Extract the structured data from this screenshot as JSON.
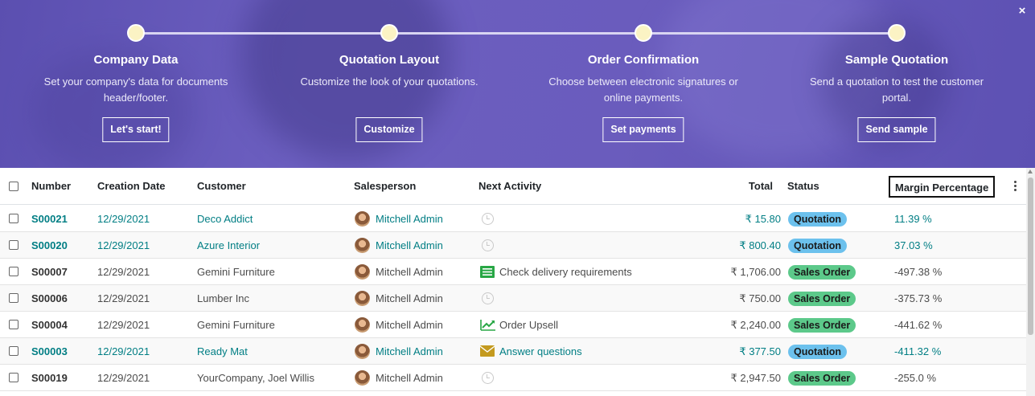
{
  "banner": {
    "close_label": "×",
    "steps": [
      {
        "title": "Company Data",
        "desc": "Set your company's data for documents header/footer.",
        "button": "Let's start!"
      },
      {
        "title": "Quotation Layout",
        "desc": "Customize the look of your quotations.",
        "button": "Customize"
      },
      {
        "title": "Order Confirmation",
        "desc": "Choose between electronic signatures or online payments.",
        "button": "Set payments"
      },
      {
        "title": "Sample Quotation",
        "desc": "Send a quotation to test the customer portal.",
        "button": "Send sample"
      }
    ]
  },
  "table": {
    "headers": {
      "number": "Number",
      "creation_date": "Creation Date",
      "customer": "Customer",
      "salesperson": "Salesperson",
      "next_activity": "Next Activity",
      "total": "Total",
      "status": "Status",
      "margin": "Margin Percentage"
    },
    "rows": [
      {
        "number": "S00021",
        "date": "12/29/2021",
        "customer": "Deco Addict",
        "salesperson": "Mitchell Admin",
        "activity": "",
        "activity_icon": "clock-icon",
        "total": "₹ 15.80",
        "status": "Quotation",
        "margin": "11.39 %"
      },
      {
        "number": "S00020",
        "date": "12/29/2021",
        "customer": "Azure Interior",
        "salesperson": "Mitchell Admin",
        "activity": "",
        "activity_icon": "clock-icon",
        "total": "₹ 800.40",
        "status": "Quotation",
        "margin": "37.03 %"
      },
      {
        "number": "S00007",
        "date": "12/29/2021",
        "customer": "Gemini Furniture",
        "salesperson": "Mitchell Admin",
        "activity": "Check delivery requirements",
        "activity_icon": "tasks-icon",
        "total": "₹ 1,706.00",
        "status": "Sales Order",
        "margin": "-497.38 %"
      },
      {
        "number": "S00006",
        "date": "12/29/2021",
        "customer": "Lumber Inc",
        "salesperson": "Mitchell Admin",
        "activity": "",
        "activity_icon": "clock-icon",
        "total": "₹ 750.00",
        "status": "Sales Order",
        "margin": "-375.73 %"
      },
      {
        "number": "S00004",
        "date": "12/29/2021",
        "customer": "Gemini Furniture",
        "salesperson": "Mitchell Admin",
        "activity": "Order Upsell",
        "activity_icon": "line-chart-icon",
        "total": "₹ 2,240.00",
        "status": "Sales Order",
        "margin": "-441.62 %"
      },
      {
        "number": "S00003",
        "date": "12/29/2021",
        "customer": "Ready Mat",
        "salesperson": "Mitchell Admin",
        "activity": "Answer questions",
        "activity_icon": "envelope-icon",
        "total": "₹ 377.50",
        "status": "Quotation",
        "margin": "-411.32 %"
      },
      {
        "number": "S00019",
        "date": "12/29/2021",
        "customer": "YourCompany, Joel Willis",
        "salesperson": "Mitchell Admin",
        "activity": "",
        "activity_icon": "clock-icon",
        "total": "₹ 2,947.50",
        "status": "Sales Order",
        "margin": "-255.0 %"
      }
    ]
  },
  "colors": {
    "banner": "#6a5cbd",
    "link": "#017e84",
    "quotation_badge": "#6cc1ed",
    "sales_order_badge": "#5cc98a"
  }
}
